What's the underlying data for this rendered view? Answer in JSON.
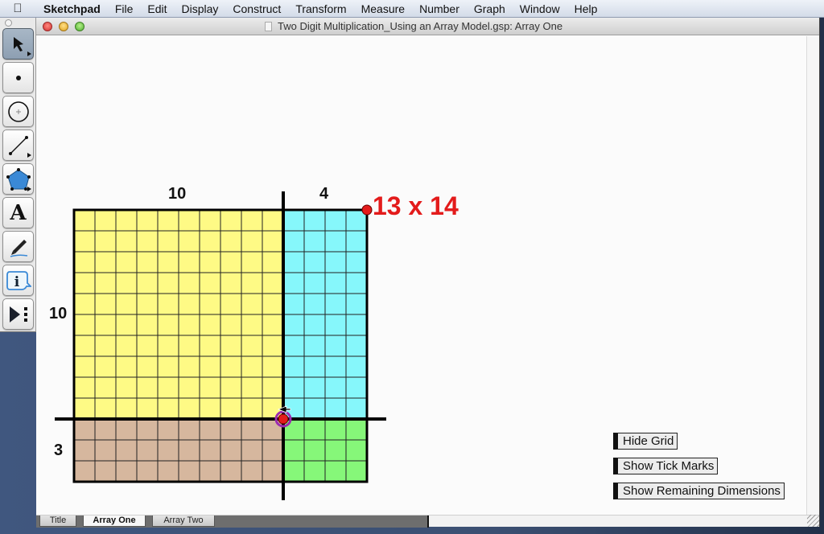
{
  "menubar": {
    "apple_icon": "apple-icon",
    "app_name": "Sketchpad",
    "items": [
      "File",
      "Edit",
      "Display",
      "Construct",
      "Transform",
      "Measure",
      "Number",
      "Graph",
      "Window",
      "Help"
    ]
  },
  "toolbox": {
    "tools": [
      {
        "name": "selection-arrow-tool",
        "icon": "arrow-pointer-icon",
        "active": true,
        "has_submenu": true
      },
      {
        "name": "point-tool",
        "icon": "point-icon",
        "active": false,
        "has_submenu": false
      },
      {
        "name": "compass-tool",
        "icon": "circle-icon",
        "active": false,
        "has_submenu": false
      },
      {
        "name": "straightedge-tool",
        "icon": "segment-icon",
        "active": false,
        "has_submenu": true
      },
      {
        "name": "polygon-tool",
        "icon": "pentagon-icon",
        "active": false,
        "has_submenu": true
      },
      {
        "name": "text-tool",
        "icon": "text-A-icon",
        "active": false,
        "has_submenu": false
      },
      {
        "name": "marker-tool",
        "icon": "marker-icon",
        "active": false,
        "has_submenu": false
      },
      {
        "name": "information-tool",
        "icon": "info-icon",
        "active": false,
        "has_submenu": false
      },
      {
        "name": "custom-tool",
        "icon": "play-dots-icon",
        "active": false,
        "has_submenu": false
      }
    ]
  },
  "window": {
    "title": "Two Digit Multiplication_Using an Array Model.gsp: Array One"
  },
  "sketch": {
    "expression": "13 x 14",
    "top_labels": [
      "10",
      "4"
    ],
    "side_labels": [
      "10",
      "3"
    ],
    "array": {
      "tens_cols": 10,
      "ones_cols": 4,
      "tens_rows": 10,
      "ones_rows": 3
    },
    "region_colors": {
      "tens_by_tens": "#fefa85",
      "tens_by_ones": "#86f7fb",
      "ones_by_tens": "#d6b79e",
      "ones_by_ones": "#86f779"
    },
    "point_color": "#e31b1b",
    "selection_color": "#9c2bb0"
  },
  "buttons": {
    "hide_grid": "Hide Grid",
    "show_tick_marks": "Show Tick Marks",
    "show_remaining_dimensions": "Show Remaining Dimensions"
  },
  "page_tabs": [
    {
      "label": "Title",
      "active": false
    },
    {
      "label": "Array One",
      "active": true
    },
    {
      "label": "Array Two",
      "active": false
    }
  ]
}
